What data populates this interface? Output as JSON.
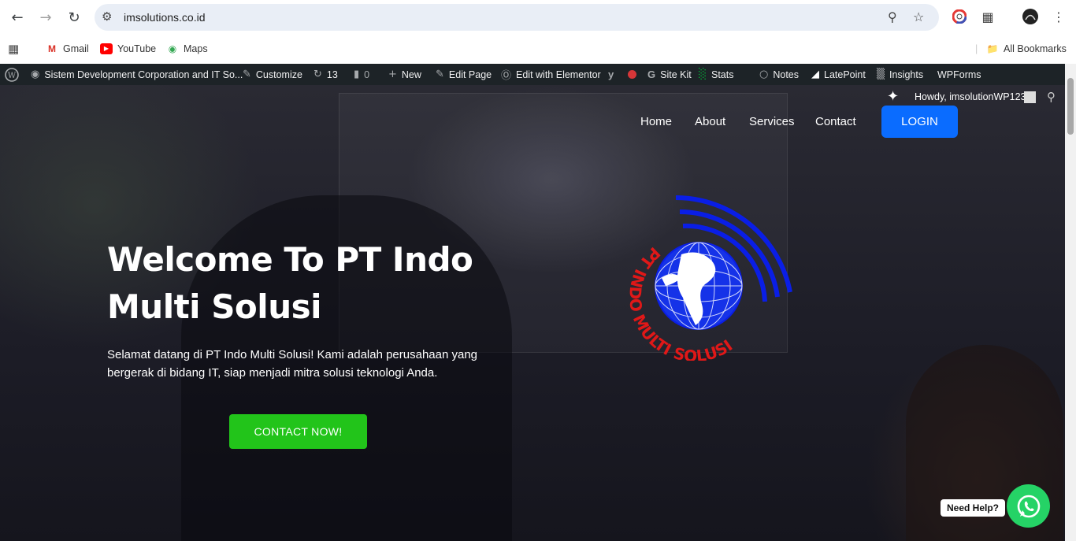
{
  "browser": {
    "url": "imsolutions.co.id",
    "bookmarks": [
      {
        "label": "Gmail",
        "icon": "gmail-icon"
      },
      {
        "label": "YouTube",
        "icon": "youtube-icon"
      },
      {
        "label": "Maps",
        "icon": "maps-icon"
      }
    ],
    "all_bookmarks": "All Bookmarks"
  },
  "adminbar": {
    "site_name": "Sistem Development Corporation and IT So...",
    "customize": "Customize",
    "updates": "13",
    "comments": "0",
    "new": "New",
    "edit_page": "Edit Page",
    "edit_elementor": "Edit with Elementor",
    "site_kit": "Site Kit",
    "stats": "Stats",
    "notes": "Notes",
    "latepoint": "LatePoint",
    "insights": "Insights",
    "wpforms": "WPForms",
    "howdy": "Howdy, imsolutionWP123"
  },
  "nav": {
    "items": [
      "Home",
      "About",
      "Services",
      "Contact"
    ],
    "login": "LOGIN"
  },
  "hero": {
    "headline_line1": "Welcome To PT Indo",
    "headline_line2": "Multi Solusi",
    "subtext": "Selamat datang di PT Indo Multi Solusi! Kami adalah perusahaan yang bergerak di bidang IT, siap menjadi mitra solusi teknologi Anda.",
    "cta": "CONTACT NOW!",
    "logo_text": "PT INDO MULTI SOLUSI"
  },
  "widget": {
    "need_help": "Need Help?"
  },
  "colors": {
    "login": "#0a6cff",
    "cta": "#22c41a",
    "whatsapp": "#25d366",
    "adminbar": "#1d2327",
    "logo_blue": "#0a1ee6",
    "logo_red": "#e01818"
  }
}
